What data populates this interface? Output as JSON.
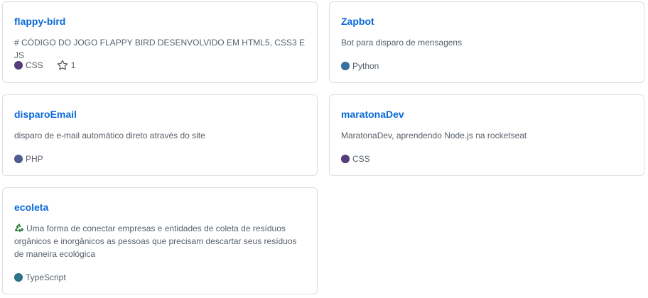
{
  "repos": [
    {
      "name": "flappy-bird",
      "description": "# CÓDIGO DO JOGO FLAPPY BIRD DESENVOLVIDO EM HTML5, CSS3 E JS",
      "language": "CSS",
      "language_color": "#563d7c",
      "stars": "1",
      "star_icon": "star-icon"
    },
    {
      "name": "Zapbot",
      "description": "Bot para disparo de mensagens",
      "language": "Python",
      "language_color": "#3572A5"
    },
    {
      "name": "disparoEmail",
      "description": "disparo de e-mail automático direto através do site",
      "language": "PHP",
      "language_color": "#4F5D95"
    },
    {
      "name": "maratonaDev",
      "description": "MaratonaDev, aprendendo Node.js na rocketseat",
      "language": "CSS",
      "language_color": "#563d7c"
    },
    {
      "name": "ecoleta",
      "description_emoji": "recycle-emoji-icon",
      "description": "Uma forma de conectar empresas e entidades de coleta de resíduos orgânicos e inorgânicos as pessoas que precisam descartar seus resíduos de maneira ecológica",
      "language": "TypeScript",
      "language_color": "#2b7489"
    }
  ]
}
